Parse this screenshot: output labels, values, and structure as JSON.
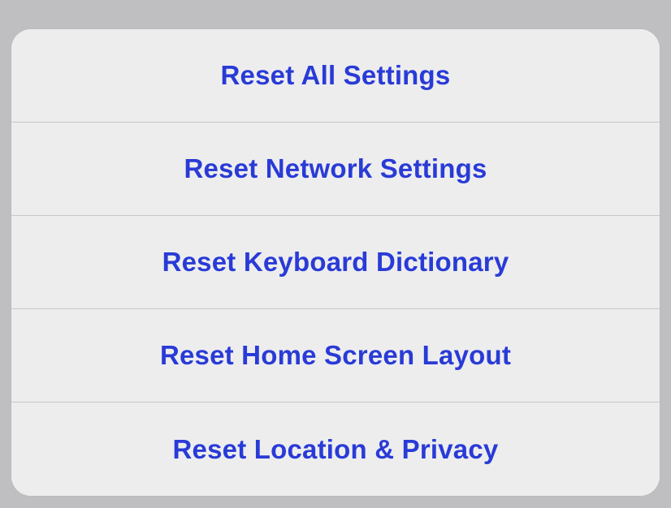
{
  "menu": {
    "items": [
      {
        "label": "Reset All Settings"
      },
      {
        "label": "Reset Network Settings"
      },
      {
        "label": "Reset Keyboard Dictionary"
      },
      {
        "label": "Reset Home Screen Layout"
      },
      {
        "label": "Reset Location & Privacy"
      }
    ]
  }
}
